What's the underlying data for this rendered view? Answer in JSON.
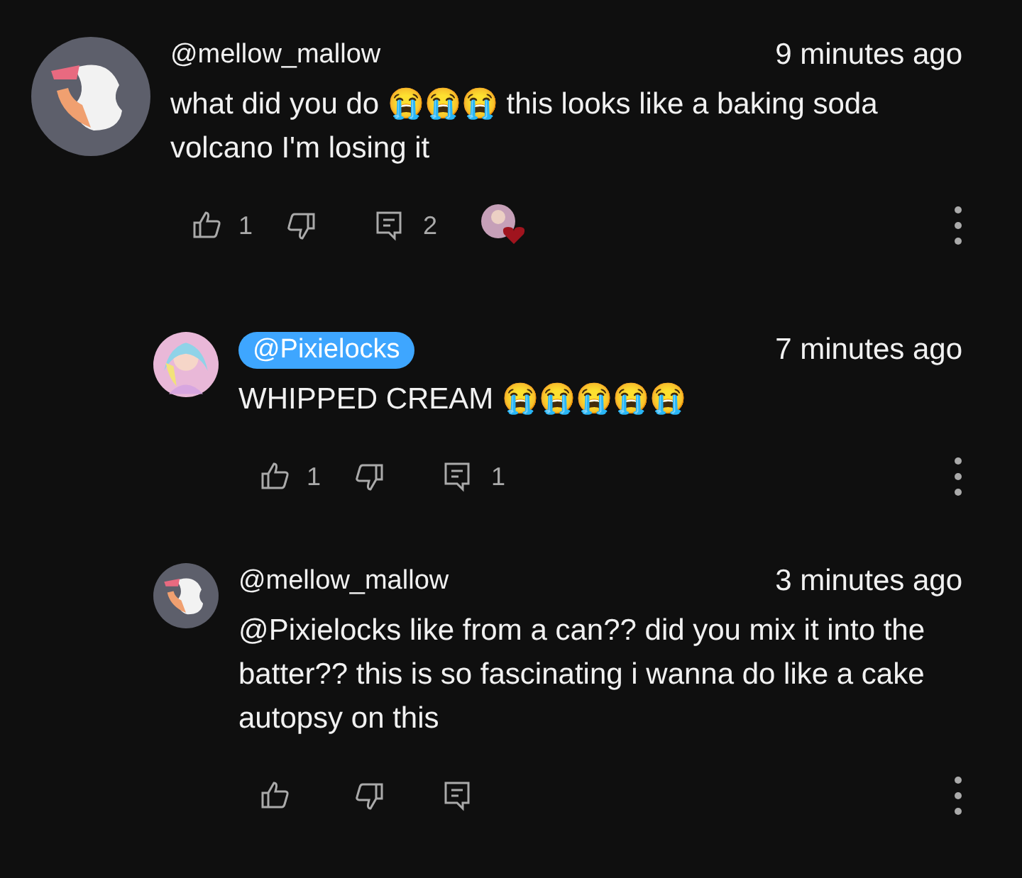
{
  "comments": [
    {
      "author": "@mellow_mallow",
      "creator": false,
      "time": "9 minutes ago",
      "text": "what did you do 😭😭😭 this looks like a baking soda volcano I'm losing it",
      "likes": "1",
      "replies": "2",
      "hearted": true,
      "children": [
        {
          "author": "@Pixielocks",
          "creator": true,
          "time": "7 minutes ago",
          "text": "WHIPPED CREAM 😭😭😭😭😭",
          "likes": "1",
          "replies": "1",
          "hearted": false
        },
        {
          "author": "@mellow_mallow",
          "creator": false,
          "time": "3 minutes ago",
          "text": "@Pixielocks like from a can?? did you mix it into the batter?? this is so fascinating i wanna do like a cake autopsy on this",
          "hearted": false
        }
      ]
    }
  ]
}
